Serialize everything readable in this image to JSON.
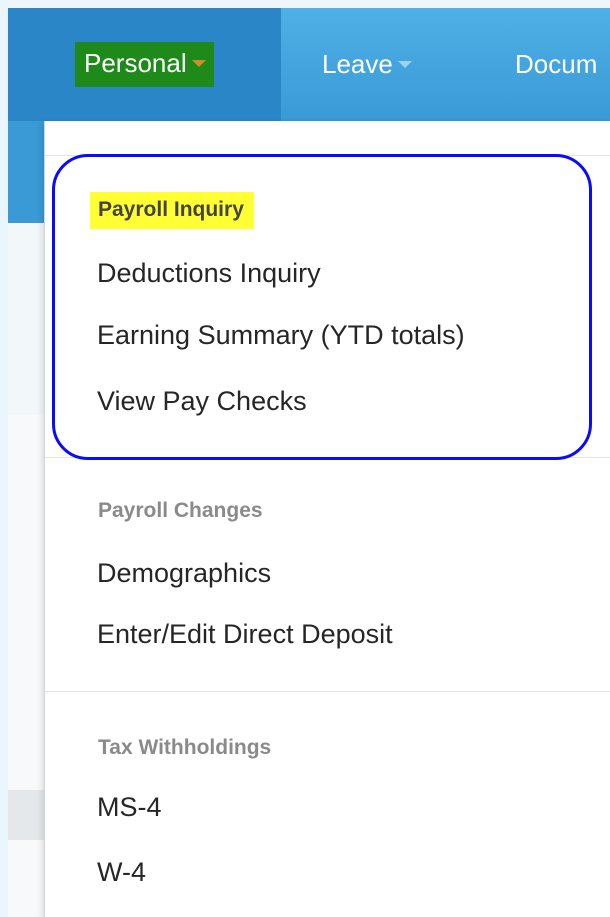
{
  "nav": {
    "personal_label": "Personal",
    "leave_label": "Leave",
    "documents_label": "Docum"
  },
  "menu": {
    "section1": {
      "header": "Payroll Inquiry",
      "items": [
        "Deductions Inquiry",
        "Earning Summary (YTD totals)",
        "View Pay Checks"
      ]
    },
    "section2": {
      "header": "Payroll Changes",
      "items": [
        "Demographics",
        "Enter/Edit Direct Deposit"
      ]
    },
    "section3": {
      "header": "Tax Withholdings",
      "items": [
        "MS-4",
        "W-4"
      ]
    }
  },
  "colors": {
    "navbar": "#3a9ad6",
    "green_highlight": "#1e8a1a",
    "yellow_highlight": "#ffff33",
    "annotation_border": "#0a0aff"
  },
  "icons": [
    "caret-down-icon"
  ]
}
